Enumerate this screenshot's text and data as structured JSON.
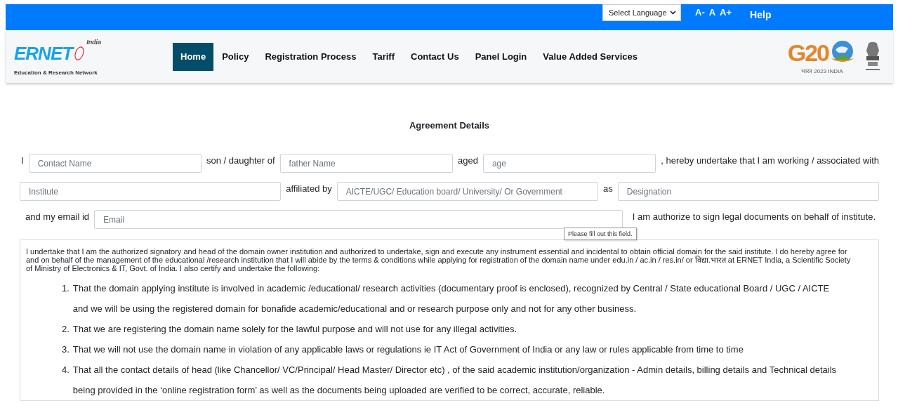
{
  "top_bar": {
    "language_select": {
      "value": "Select Language"
    },
    "font_sizes": [
      "A-",
      "A",
      "A+"
    ],
    "help": "Help"
  },
  "header": {
    "logo": {
      "name": "ERNET",
      "tag": "India",
      "subtitle": "Education & Research Network"
    },
    "nav": [
      {
        "label": "Home",
        "selected": true
      },
      {
        "label": "Policy",
        "selected": false
      },
      {
        "label": "Registration Process",
        "selected": false
      },
      {
        "label": "Tariff",
        "selected": false
      },
      {
        "label": "Contact Us",
        "selected": false
      },
      {
        "label": "Panel Login",
        "selected": false
      },
      {
        "label": "Value Added Services",
        "selected": false
      }
    ],
    "g20": {
      "mark": "G20",
      "caption": "भारत 2023 INDIA"
    }
  },
  "title": "Agreement Details",
  "form": [
    [
      {
        "kind": "text",
        "text": "I"
      },
      {
        "kind": "field",
        "placeholder": "Contact Name"
      },
      {
        "kind": "text",
        "text": "son / daughter of"
      },
      {
        "kind": "field",
        "placeholder": "father Name"
      },
      {
        "kind": "text",
        "text": "aged"
      },
      {
        "kind": "field",
        "placeholder": "age"
      },
      {
        "kind": "text",
        "text": ", hereby undertake that I am working / associated with"
      }
    ],
    [
      {
        "kind": "field",
        "placeholder": "Institute"
      },
      {
        "kind": "text",
        "text": "affiliated by"
      },
      {
        "kind": "field",
        "placeholder": "AICTE/UGC/ Education board/ University/ Or Government"
      },
      {
        "kind": "text",
        "text": "as"
      },
      {
        "kind": "field",
        "placeholder": "Designation"
      }
    ],
    [
      {
        "kind": "text",
        "text": "and my email id"
      },
      {
        "kind": "field",
        "placeholder": "Email"
      },
      {
        "kind": "text",
        "text": "I am authorize to sign legal documents on behalf of institute."
      }
    ]
  ],
  "tooltip": "Please fill out this field.",
  "agreement": {
    "intro": "I undertake that I am the authorized signatory and head of the domain owner institution and authorized to undertake, sign and execute any instrument essential and incidental to obtain official domain for the said institute. I do hereby agree for and on behalf of the management of the educational /research institution that I will abide by the terms & conditions while applying for registration of the domain name under edu.in / ac.in / res.in/ or विद्या.भारत at ERNET India, a Scientific Society of Ministry of Electronics & IT, Govt. of India. I also certify and undertake the following:",
    "points": [
      {
        "number": "1.",
        "text": "That the domain applying institute is involved in academic /educational/ research activities (documentary proof is enclosed), recognized by Central / State educational Board / UGC / AICTE and we will be using the registered domain for bonafide academic/educational and or research purpose only and not for any other business."
      },
      {
        "number": "2.",
        "text": "That we are registering the domain name solely for the lawful purpose and will not use for any illegal activities."
      },
      {
        "number": "3.",
        "text": "That we will not use the domain name in violation of any applicable laws or regulations ie IT Act of Government of India or any law or rules applicable from time to time"
      },
      {
        "number": "4.",
        "text": "That all the contact details of head (like Chancellor/ VC/Principal/ Head Master/ Director etc) , of the said academic institution/organization - Admin details, billing details and Technical details being provided in the ‘online registration form’ as well as the documents being uploaded are verified to be correct, accurate, reliable."
      }
    ]
  }
}
